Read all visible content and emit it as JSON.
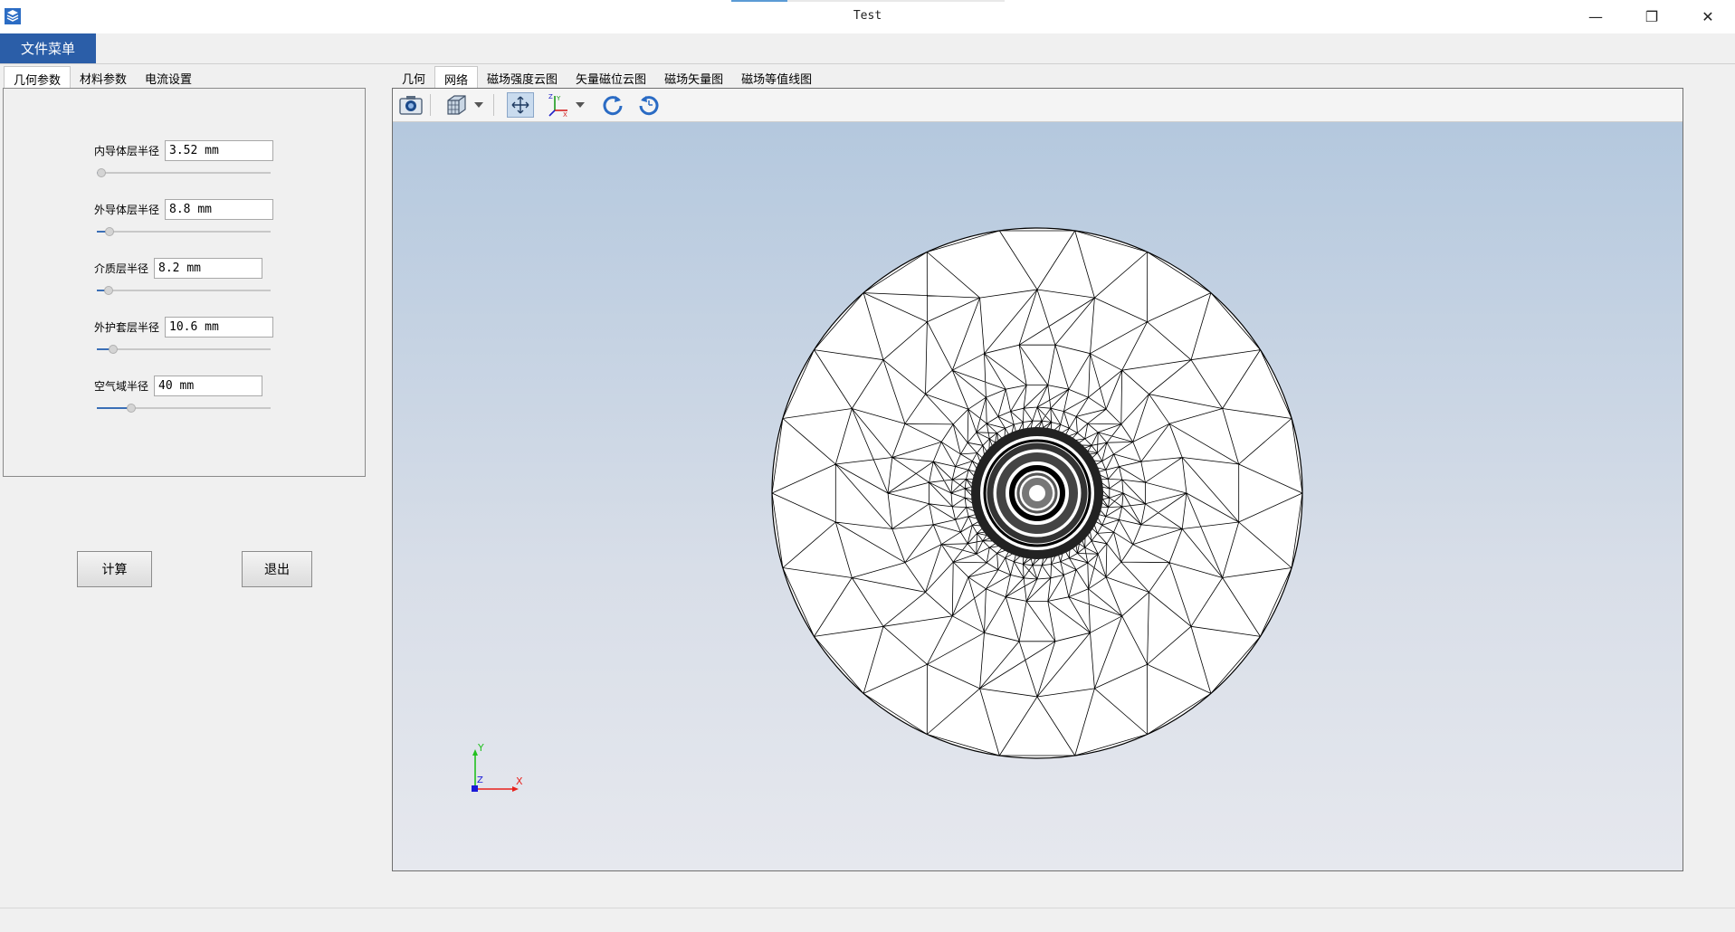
{
  "window": {
    "title": "Test",
    "minimize_glyph": "—",
    "restore_glyph": "❐",
    "close_glyph": "✕",
    "app_icon": "stack-layers-icon"
  },
  "menu": {
    "file_menu_label": "文件菜单"
  },
  "left_tabs": [
    "几何参数",
    "材料参数",
    "电流设置"
  ],
  "parameters": [
    {
      "label": "内导体层半径",
      "value": "3.52 mm",
      "slider_level": 0.0
    },
    {
      "label": "外导体层半径",
      "value": "8.8 mm",
      "slider_level": 0.05
    },
    {
      "label": "介质层半径",
      "value": "8.2 mm",
      "slider_level": 0.045
    },
    {
      "label": "外护套层半径",
      "value": "10.6 mm",
      "slider_level": 0.07
    },
    {
      "label": "空气域半径",
      "value": "40 mm",
      "slider_level": 0.18
    }
  ],
  "actions": {
    "compute_label": "计算",
    "exit_label": "退出"
  },
  "view_tabs": [
    "几何",
    "网络",
    "磁场强度云图",
    "矢量磁位云图",
    "磁场矢量图",
    "磁场等值线图"
  ],
  "active_view_tab": 1,
  "toolbar_icons": [
    "camera-icon",
    "cube-view-icon",
    "dropdown-arrow-icon",
    "fit-view-icon",
    "axes-orientation-icon",
    "dropdown-arrow-icon",
    "rotate-cw-icon",
    "rotate-ccw-icon"
  ],
  "axes": {
    "x_label": "X",
    "y_label": "Y",
    "z_label": "Z"
  },
  "colors": {
    "accent": "#2b5ea8",
    "x_axis": "#e8221c",
    "y_axis": "#22c01f",
    "z_axis": "#1a1ad8"
  }
}
